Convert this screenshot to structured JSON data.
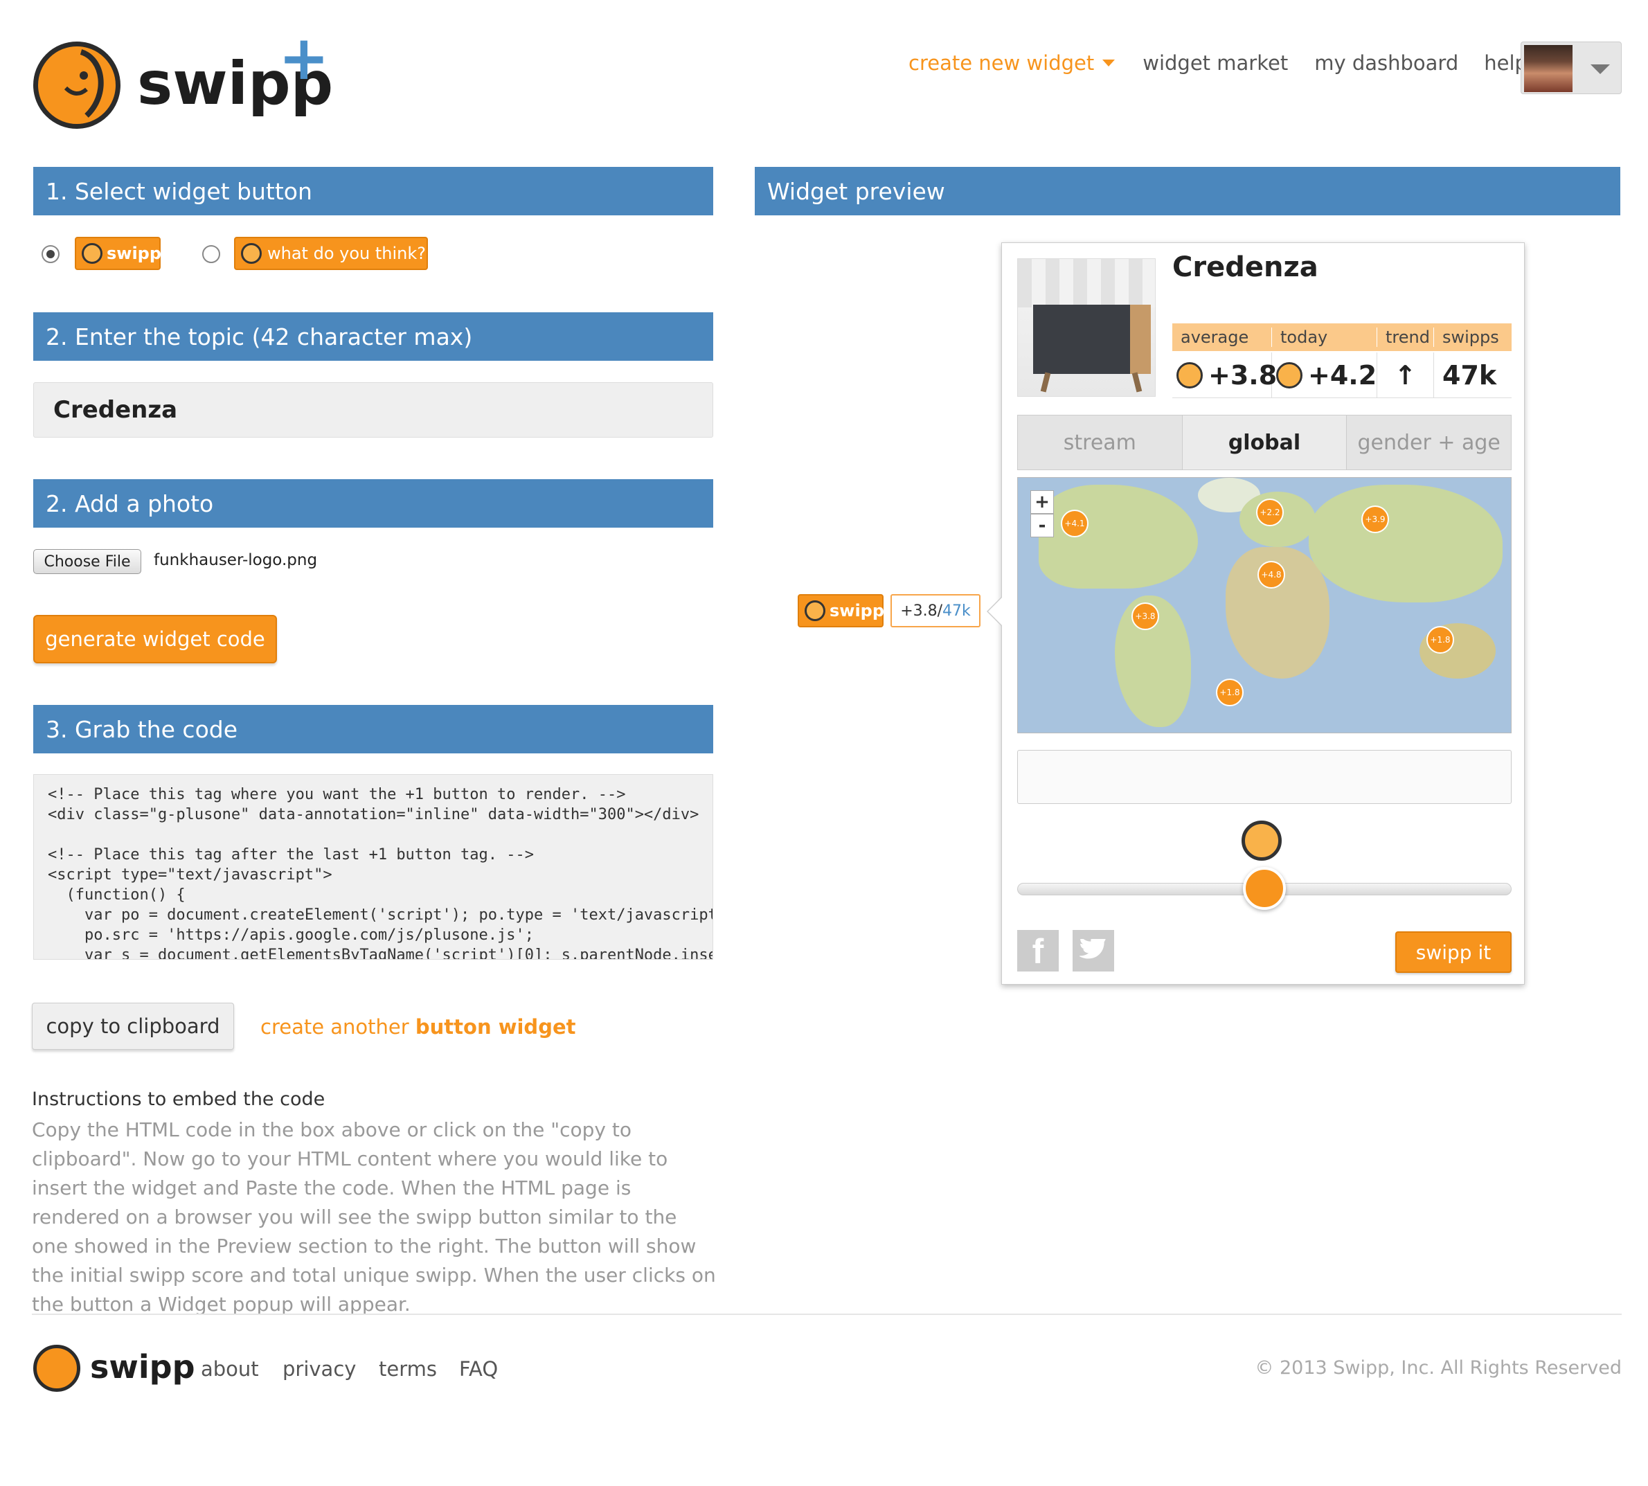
{
  "header": {
    "logo_text": "swipp",
    "logo_plus": "+",
    "nav": {
      "create": "create new widget",
      "market": "widget market",
      "dashboard": "my dashboard",
      "help": "help"
    }
  },
  "left": {
    "step1": {
      "title": "1. Select widget button",
      "option1_label": "swipp",
      "option2_label": "what do you think?"
    },
    "step2": {
      "title": "2. Enter the topic (42 character max)",
      "topic_value": "Credenza"
    },
    "step2b": {
      "title": "2. Add a photo",
      "choose_file": "Choose File",
      "file_name": "funkhauser-logo.png"
    },
    "generate_button": "generate widget code",
    "step3": {
      "title": "3. Grab the code",
      "code": "<!-- Place this tag where you want the +1 button to render. -->\n<div class=\"g-plusone\" data-annotation=\"inline\" data-width=\"300\"></div>\n\n<!-- Place this tag after the last +1 button tag. -->\n<script type=\"text/javascript\">\n  (function() {\n    var po = document.createElement('script'); po.type = 'text/javascript';\n    po.src = 'https://apis.google.com/js/plusone.js';\n    var s = document.getElementsByTagName('script')[0]; s.parentNode.insertBefore(po, s);\n  })();"
    },
    "copy_button": "copy to clipboard",
    "create_another_a": "create another",
    "create_another_b": "button widget",
    "instructions": {
      "title": "Instructions to embed the code",
      "body": "Copy the HTML code in the box above or click on the \"copy to clipboard\". Now go to your HTML content where you would like to insert the widget and Paste the code. When the HTML page is rendered on a browser you will see the swipp button similar to the one showed in the Preview section to the right. The button will show the initial swipp score and total unique swipp. When the user clicks on the button a Widget popup will appear."
    }
  },
  "preview": {
    "title": "Widget preview",
    "button_label": "swipp",
    "score": "+3.8/",
    "count": "47k",
    "card": {
      "topic": "Credenza",
      "headers": {
        "average": "average",
        "today": "today",
        "trend": "trend",
        "swipps": "swipps"
      },
      "average": "+3.8",
      "today": "+4.2",
      "trend_icon": "↑",
      "swipps": "47k",
      "tabs": [
        "stream",
        "global",
        "gender + age"
      ],
      "pins": [
        "+4.1",
        "+2.2",
        "+3.9",
        "+4.8",
        "+3.8",
        "+1.8",
        "+1.8"
      ],
      "zoom_in": "+",
      "zoom_out": "-",
      "slider_value": 0.5,
      "swipp_it": "swipp it"
    }
  },
  "footer": {
    "logo_text": "swipp",
    "links": [
      "about",
      "privacy",
      "terms",
      "FAQ"
    ],
    "copyright": "© 2013 Swipp, Inc. All Rights Reserved"
  },
  "colors": {
    "accent": "#f7941d",
    "bar": "#4b87bd",
    "plus": "#4a8fc9"
  }
}
